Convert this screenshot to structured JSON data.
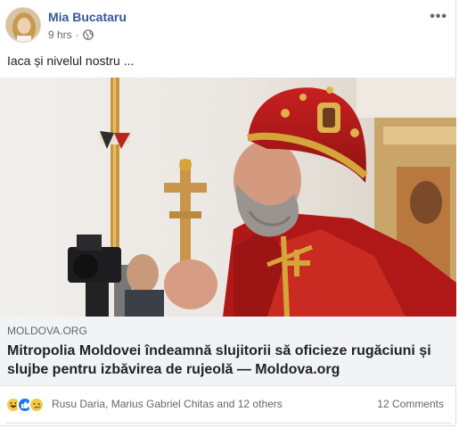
{
  "post": {
    "author": "Mia Bucataru",
    "time": "9 hrs",
    "separator": "·",
    "privacy_icon": "globe-icon",
    "text": "Iaca și nivelul nostru ..."
  },
  "link": {
    "domain": "MOLDOVA.ORG",
    "title": "Mitropolia Moldovei îndeamnă slujitorii să oficieze rugăciuni și slujbe pentru izbăvirea de rujeolă — Moldova.org"
  },
  "reactions": {
    "icons": [
      "haha-icon",
      "like-icon",
      "sad-icon"
    ],
    "names": "Rusu Daria, Marius Gabriel Chitas and 12 others",
    "comments": "12 Comments"
  },
  "colors": {
    "author_link": "#365899",
    "vestment_red": "#b01818",
    "gold": "#d6a53a"
  }
}
